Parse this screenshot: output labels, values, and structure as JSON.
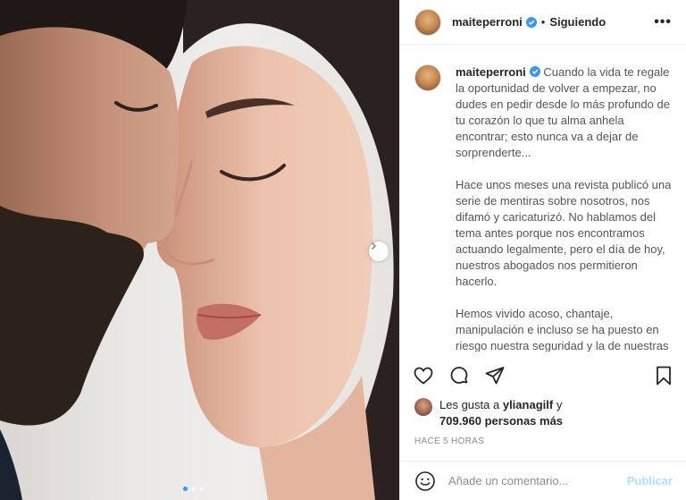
{
  "post": {
    "username": "maiteperroni",
    "follow_status": "Siguiendo",
    "bullet": "•",
    "more_glyph": "•••",
    "caption_user": "maiteperroni",
    "caption_paragraphs": [
      "Cuando la vida te regale la oportunidad de volver a empezar, no dudes en pedir desde lo más profundo de tu corazón lo que tu alma anhela encontrar; esto nunca va a dejar de sorprenderte...",
      "Hace unos meses una revista publicó una serie de mentiras sobre nosotros, nos difamó y caricaturizó. No hablamos del tema antes porque nos encontramos actuando legalmente, pero el día de hoy, nuestros abogados nos permitieron hacerlo.",
      "Hemos vivido acoso, chantaje, manipulación e incluso se ha puesto en riesgo nuestra seguridad y la de nuestras familias"
    ],
    "likes_prefix": "Les gusta a",
    "likes_user": "ylianagilf",
    "likes_connector": "y",
    "likes_count": "709.960 personas más",
    "timestamp": "HACE 5 HORAS",
    "comment_placeholder": "Añade un comentario...",
    "publish_label": "Publicar"
  },
  "carousel": {
    "current": 1,
    "total": 3
  },
  "icons": {
    "verified": "verified-badge-icon",
    "like": "heart-icon",
    "comment": "comment-bubble-icon",
    "share": "paper-plane-icon",
    "save": "bookmark-icon",
    "emoji": "emoji-icon",
    "next": "chevron-right-icon"
  },
  "colors": {
    "verified": "#3897f0",
    "publish": "#b2dffc",
    "timestamp": "#8e8e8e"
  }
}
